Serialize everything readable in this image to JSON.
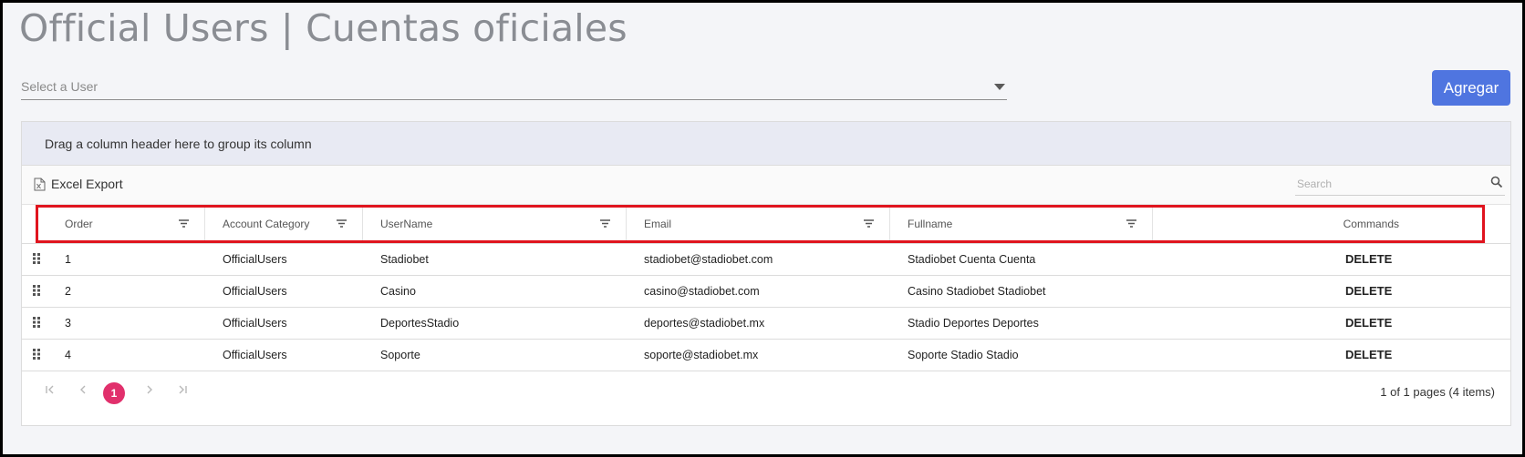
{
  "title": "Official Users | Cuentas oficiales",
  "user_select": {
    "placeholder": "Select a User"
  },
  "add_button": "Agregar",
  "grid": {
    "group_panel": "Drag a column header here to group its column",
    "excel_export": "Excel Export",
    "search_placeholder": "Search",
    "columns": [
      "Order",
      "Account Category",
      "UserName",
      "Email",
      "Fullname",
      "Commands"
    ],
    "rows": [
      {
        "order": "1",
        "category": "OfficialUsers",
        "username": "Stadiobet",
        "email": "stadiobet@stadiobet.com",
        "fullname": "Stadiobet Cuenta Cuenta",
        "command": "DELETE"
      },
      {
        "order": "2",
        "category": "OfficialUsers",
        "username": "Casino",
        "email": "casino@stadiobet.com",
        "fullname": "Casino Stadiobet Stadiobet",
        "command": "DELETE"
      },
      {
        "order": "3",
        "category": "OfficialUsers",
        "username": "DeportesStadio",
        "email": "deportes@stadiobet.mx",
        "fullname": "Stadio Deportes Deportes",
        "command": "DELETE"
      },
      {
        "order": "4",
        "category": "OfficialUsers",
        "username": "Soporte",
        "email": "soporte@stadiobet.mx",
        "fullname": "Soporte Stadio Stadio",
        "command": "DELETE"
      }
    ],
    "pager": {
      "current_page": "1",
      "info": "1 of 1 pages (4 items)"
    }
  },
  "colors": {
    "accent": "#4f75e0",
    "page_badge": "#e1306c",
    "highlight": "#e0141e",
    "group_panel": "#e8eaf3"
  }
}
